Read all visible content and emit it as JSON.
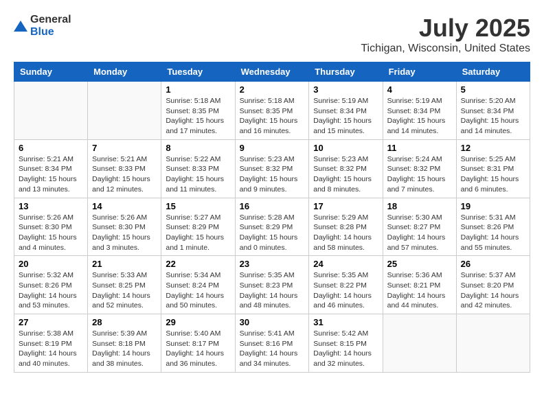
{
  "header": {
    "logo_general": "General",
    "logo_blue": "Blue",
    "month_title": "July 2025",
    "location": "Tichigan, Wisconsin, United States"
  },
  "days_of_week": [
    "Sunday",
    "Monday",
    "Tuesday",
    "Wednesday",
    "Thursday",
    "Friday",
    "Saturday"
  ],
  "weeks": [
    [
      {
        "day": "",
        "info": ""
      },
      {
        "day": "",
        "info": ""
      },
      {
        "day": "1",
        "info": "Sunrise: 5:18 AM\nSunset: 8:35 PM\nDaylight: 15 hours and 17 minutes."
      },
      {
        "day": "2",
        "info": "Sunrise: 5:18 AM\nSunset: 8:35 PM\nDaylight: 15 hours and 16 minutes."
      },
      {
        "day": "3",
        "info": "Sunrise: 5:19 AM\nSunset: 8:34 PM\nDaylight: 15 hours and 15 minutes."
      },
      {
        "day": "4",
        "info": "Sunrise: 5:19 AM\nSunset: 8:34 PM\nDaylight: 15 hours and 14 minutes."
      },
      {
        "day": "5",
        "info": "Sunrise: 5:20 AM\nSunset: 8:34 PM\nDaylight: 15 hours and 14 minutes."
      }
    ],
    [
      {
        "day": "6",
        "info": "Sunrise: 5:21 AM\nSunset: 8:34 PM\nDaylight: 15 hours and 13 minutes."
      },
      {
        "day": "7",
        "info": "Sunrise: 5:21 AM\nSunset: 8:33 PM\nDaylight: 15 hours and 12 minutes."
      },
      {
        "day": "8",
        "info": "Sunrise: 5:22 AM\nSunset: 8:33 PM\nDaylight: 15 hours and 11 minutes."
      },
      {
        "day": "9",
        "info": "Sunrise: 5:23 AM\nSunset: 8:32 PM\nDaylight: 15 hours and 9 minutes."
      },
      {
        "day": "10",
        "info": "Sunrise: 5:23 AM\nSunset: 8:32 PM\nDaylight: 15 hours and 8 minutes."
      },
      {
        "day": "11",
        "info": "Sunrise: 5:24 AM\nSunset: 8:32 PM\nDaylight: 15 hours and 7 minutes."
      },
      {
        "day": "12",
        "info": "Sunrise: 5:25 AM\nSunset: 8:31 PM\nDaylight: 15 hours and 6 minutes."
      }
    ],
    [
      {
        "day": "13",
        "info": "Sunrise: 5:26 AM\nSunset: 8:30 PM\nDaylight: 15 hours and 4 minutes."
      },
      {
        "day": "14",
        "info": "Sunrise: 5:26 AM\nSunset: 8:30 PM\nDaylight: 15 hours and 3 minutes."
      },
      {
        "day": "15",
        "info": "Sunrise: 5:27 AM\nSunset: 8:29 PM\nDaylight: 15 hours and 1 minute."
      },
      {
        "day": "16",
        "info": "Sunrise: 5:28 AM\nSunset: 8:29 PM\nDaylight: 15 hours and 0 minutes."
      },
      {
        "day": "17",
        "info": "Sunrise: 5:29 AM\nSunset: 8:28 PM\nDaylight: 14 hours and 58 minutes."
      },
      {
        "day": "18",
        "info": "Sunrise: 5:30 AM\nSunset: 8:27 PM\nDaylight: 14 hours and 57 minutes."
      },
      {
        "day": "19",
        "info": "Sunrise: 5:31 AM\nSunset: 8:26 PM\nDaylight: 14 hours and 55 minutes."
      }
    ],
    [
      {
        "day": "20",
        "info": "Sunrise: 5:32 AM\nSunset: 8:26 PM\nDaylight: 14 hours and 53 minutes."
      },
      {
        "day": "21",
        "info": "Sunrise: 5:33 AM\nSunset: 8:25 PM\nDaylight: 14 hours and 52 minutes."
      },
      {
        "day": "22",
        "info": "Sunrise: 5:34 AM\nSunset: 8:24 PM\nDaylight: 14 hours and 50 minutes."
      },
      {
        "day": "23",
        "info": "Sunrise: 5:35 AM\nSunset: 8:23 PM\nDaylight: 14 hours and 48 minutes."
      },
      {
        "day": "24",
        "info": "Sunrise: 5:35 AM\nSunset: 8:22 PM\nDaylight: 14 hours and 46 minutes."
      },
      {
        "day": "25",
        "info": "Sunrise: 5:36 AM\nSunset: 8:21 PM\nDaylight: 14 hours and 44 minutes."
      },
      {
        "day": "26",
        "info": "Sunrise: 5:37 AM\nSunset: 8:20 PM\nDaylight: 14 hours and 42 minutes."
      }
    ],
    [
      {
        "day": "27",
        "info": "Sunrise: 5:38 AM\nSunset: 8:19 PM\nDaylight: 14 hours and 40 minutes."
      },
      {
        "day": "28",
        "info": "Sunrise: 5:39 AM\nSunset: 8:18 PM\nDaylight: 14 hours and 38 minutes."
      },
      {
        "day": "29",
        "info": "Sunrise: 5:40 AM\nSunset: 8:17 PM\nDaylight: 14 hours and 36 minutes."
      },
      {
        "day": "30",
        "info": "Sunrise: 5:41 AM\nSunset: 8:16 PM\nDaylight: 14 hours and 34 minutes."
      },
      {
        "day": "31",
        "info": "Sunrise: 5:42 AM\nSunset: 8:15 PM\nDaylight: 14 hours and 32 minutes."
      },
      {
        "day": "",
        "info": ""
      },
      {
        "day": "",
        "info": ""
      }
    ]
  ]
}
